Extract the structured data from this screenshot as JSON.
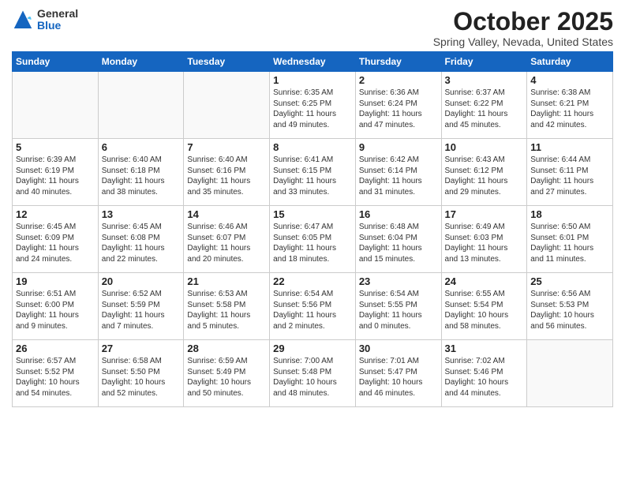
{
  "logo": {
    "general": "General",
    "blue": "Blue"
  },
  "header": {
    "month": "October 2025",
    "location": "Spring Valley, Nevada, United States"
  },
  "weekdays": [
    "Sunday",
    "Monday",
    "Tuesday",
    "Wednesday",
    "Thursday",
    "Friday",
    "Saturday"
  ],
  "weeks": [
    [
      {
        "day": "",
        "info": ""
      },
      {
        "day": "",
        "info": ""
      },
      {
        "day": "",
        "info": ""
      },
      {
        "day": "1",
        "info": "Sunrise: 6:35 AM\nSunset: 6:25 PM\nDaylight: 11 hours\nand 49 minutes."
      },
      {
        "day": "2",
        "info": "Sunrise: 6:36 AM\nSunset: 6:24 PM\nDaylight: 11 hours\nand 47 minutes."
      },
      {
        "day": "3",
        "info": "Sunrise: 6:37 AM\nSunset: 6:22 PM\nDaylight: 11 hours\nand 45 minutes."
      },
      {
        "day": "4",
        "info": "Sunrise: 6:38 AM\nSunset: 6:21 PM\nDaylight: 11 hours\nand 42 minutes."
      }
    ],
    [
      {
        "day": "5",
        "info": "Sunrise: 6:39 AM\nSunset: 6:19 PM\nDaylight: 11 hours\nand 40 minutes."
      },
      {
        "day": "6",
        "info": "Sunrise: 6:40 AM\nSunset: 6:18 PM\nDaylight: 11 hours\nand 38 minutes."
      },
      {
        "day": "7",
        "info": "Sunrise: 6:40 AM\nSunset: 6:16 PM\nDaylight: 11 hours\nand 35 minutes."
      },
      {
        "day": "8",
        "info": "Sunrise: 6:41 AM\nSunset: 6:15 PM\nDaylight: 11 hours\nand 33 minutes."
      },
      {
        "day": "9",
        "info": "Sunrise: 6:42 AM\nSunset: 6:14 PM\nDaylight: 11 hours\nand 31 minutes."
      },
      {
        "day": "10",
        "info": "Sunrise: 6:43 AM\nSunset: 6:12 PM\nDaylight: 11 hours\nand 29 minutes."
      },
      {
        "day": "11",
        "info": "Sunrise: 6:44 AM\nSunset: 6:11 PM\nDaylight: 11 hours\nand 27 minutes."
      }
    ],
    [
      {
        "day": "12",
        "info": "Sunrise: 6:45 AM\nSunset: 6:09 PM\nDaylight: 11 hours\nand 24 minutes."
      },
      {
        "day": "13",
        "info": "Sunrise: 6:45 AM\nSunset: 6:08 PM\nDaylight: 11 hours\nand 22 minutes."
      },
      {
        "day": "14",
        "info": "Sunrise: 6:46 AM\nSunset: 6:07 PM\nDaylight: 11 hours\nand 20 minutes."
      },
      {
        "day": "15",
        "info": "Sunrise: 6:47 AM\nSunset: 6:05 PM\nDaylight: 11 hours\nand 18 minutes."
      },
      {
        "day": "16",
        "info": "Sunrise: 6:48 AM\nSunset: 6:04 PM\nDaylight: 11 hours\nand 15 minutes."
      },
      {
        "day": "17",
        "info": "Sunrise: 6:49 AM\nSunset: 6:03 PM\nDaylight: 11 hours\nand 13 minutes."
      },
      {
        "day": "18",
        "info": "Sunrise: 6:50 AM\nSunset: 6:01 PM\nDaylight: 11 hours\nand 11 minutes."
      }
    ],
    [
      {
        "day": "19",
        "info": "Sunrise: 6:51 AM\nSunset: 6:00 PM\nDaylight: 11 hours\nand 9 minutes."
      },
      {
        "day": "20",
        "info": "Sunrise: 6:52 AM\nSunset: 5:59 PM\nDaylight: 11 hours\nand 7 minutes."
      },
      {
        "day": "21",
        "info": "Sunrise: 6:53 AM\nSunset: 5:58 PM\nDaylight: 11 hours\nand 5 minutes."
      },
      {
        "day": "22",
        "info": "Sunrise: 6:54 AM\nSunset: 5:56 PM\nDaylight: 11 hours\nand 2 minutes."
      },
      {
        "day": "23",
        "info": "Sunrise: 6:54 AM\nSunset: 5:55 PM\nDaylight: 11 hours\nand 0 minutes."
      },
      {
        "day": "24",
        "info": "Sunrise: 6:55 AM\nSunset: 5:54 PM\nDaylight: 10 hours\nand 58 minutes."
      },
      {
        "day": "25",
        "info": "Sunrise: 6:56 AM\nSunset: 5:53 PM\nDaylight: 10 hours\nand 56 minutes."
      }
    ],
    [
      {
        "day": "26",
        "info": "Sunrise: 6:57 AM\nSunset: 5:52 PM\nDaylight: 10 hours\nand 54 minutes."
      },
      {
        "day": "27",
        "info": "Sunrise: 6:58 AM\nSunset: 5:50 PM\nDaylight: 10 hours\nand 52 minutes."
      },
      {
        "day": "28",
        "info": "Sunrise: 6:59 AM\nSunset: 5:49 PM\nDaylight: 10 hours\nand 50 minutes."
      },
      {
        "day": "29",
        "info": "Sunrise: 7:00 AM\nSunset: 5:48 PM\nDaylight: 10 hours\nand 48 minutes."
      },
      {
        "day": "30",
        "info": "Sunrise: 7:01 AM\nSunset: 5:47 PM\nDaylight: 10 hours\nand 46 minutes."
      },
      {
        "day": "31",
        "info": "Sunrise: 7:02 AM\nSunset: 5:46 PM\nDaylight: 10 hours\nand 44 minutes."
      },
      {
        "day": "",
        "info": ""
      }
    ]
  ]
}
